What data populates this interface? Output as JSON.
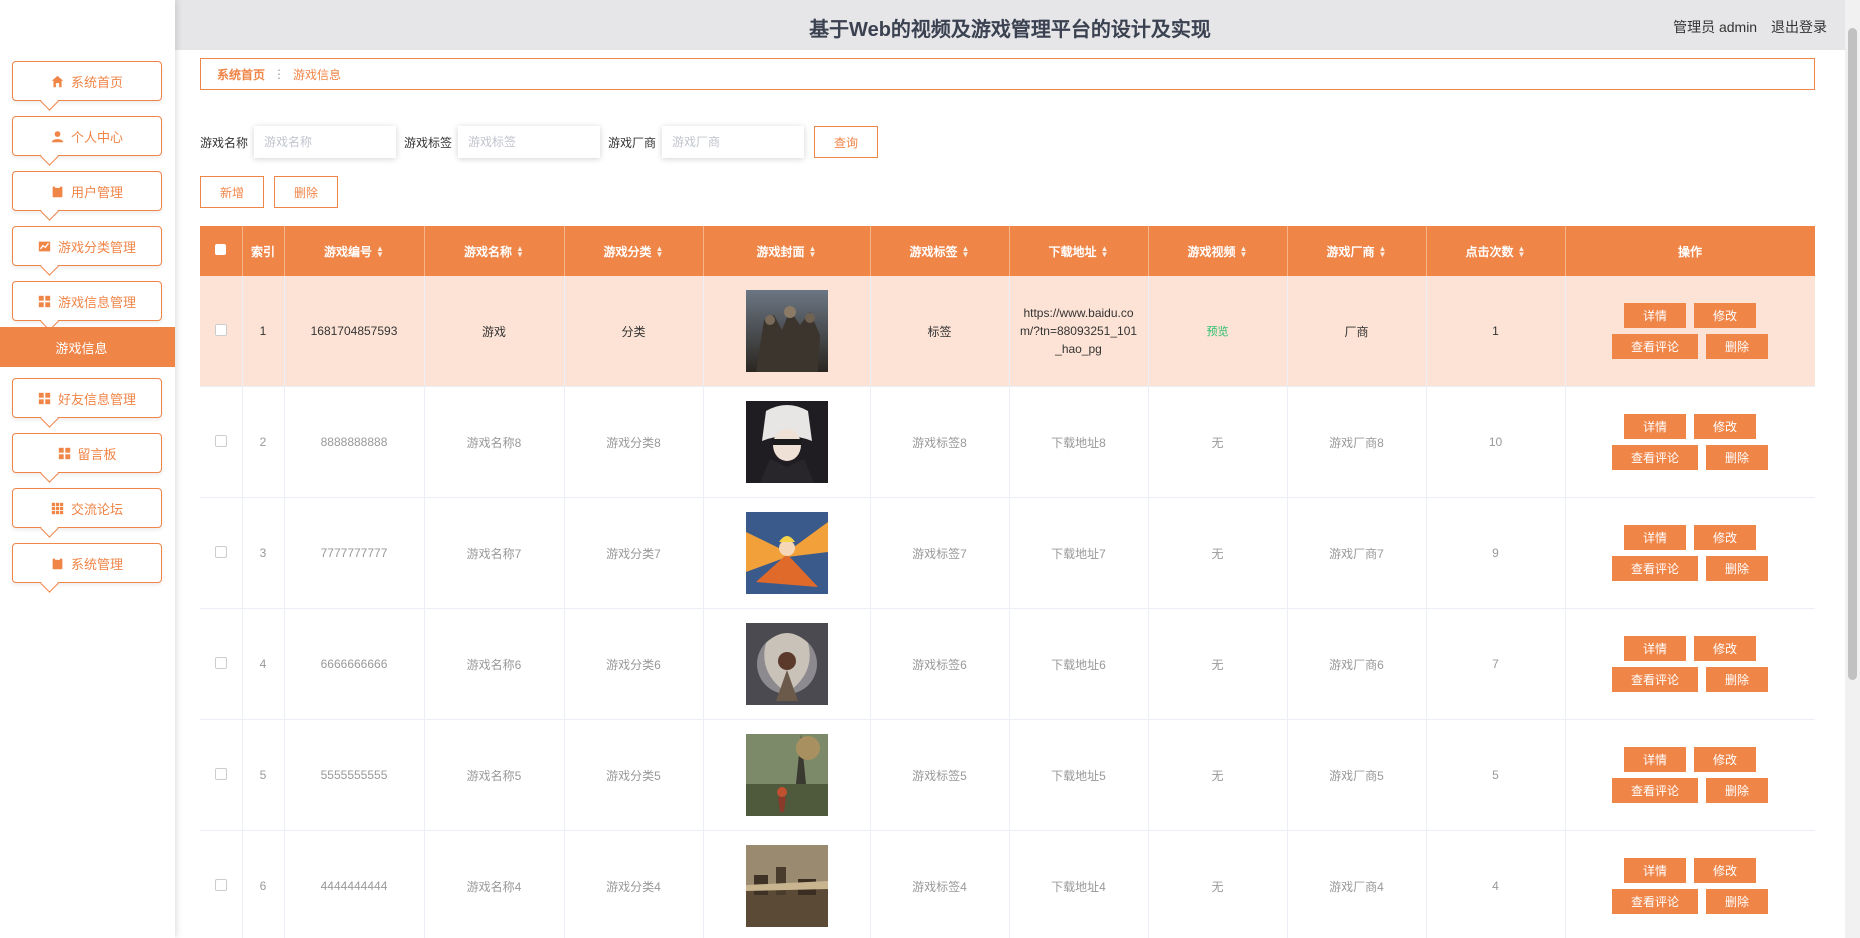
{
  "header": {
    "title": "基于Web的视频及游戏管理平台的设计及实现",
    "user_label": "管理员 admin",
    "logout": "退出登录"
  },
  "sidebar": {
    "items": [
      {
        "label": "系统首页",
        "icon": "home-icon"
      },
      {
        "label": "个人中心",
        "icon": "user-icon"
      },
      {
        "label": "用户管理",
        "icon": "clipboard-icon"
      },
      {
        "label": "游戏分类管理",
        "icon": "chart-icon"
      },
      {
        "label": "游戏信息管理",
        "icon": "grid-icon"
      },
      {
        "label": "好友信息管理",
        "icon": "grid-icon"
      },
      {
        "label": "留言板",
        "icon": "grid-icon"
      },
      {
        "label": "交流论坛",
        "icon": "apps-icon"
      },
      {
        "label": "系统管理",
        "icon": "clipboard-icon"
      }
    ],
    "active_sub": "游戏信息"
  },
  "breadcrumb": {
    "home": "系统首页",
    "current": "游戏信息"
  },
  "search": {
    "fields": [
      {
        "label": "游戏名称",
        "placeholder": "游戏名称"
      },
      {
        "label": "游戏标签",
        "placeholder": "游戏标签"
      },
      {
        "label": "游戏厂商",
        "placeholder": "游戏厂商"
      }
    ],
    "query_label": "查询"
  },
  "actions": {
    "add_label": "新增",
    "delete_label": "删除"
  },
  "table": {
    "columns": [
      "索引",
      "游戏编号",
      "游戏名称",
      "游戏分类",
      "游戏封面",
      "游戏标签",
      "下载地址",
      "游戏视频",
      "游戏厂商",
      "点击次数",
      "操作"
    ],
    "rows": [
      {
        "index": "1",
        "code": "1681704857593",
        "name": "游戏",
        "category": "分类",
        "tag": "标签",
        "url": "https://www.baidu.com/?tn=88093251_101_hao_pg",
        "video": "预览",
        "vendor": "厂商",
        "clicks": "1"
      },
      {
        "index": "2",
        "code": "8888888888",
        "name": "游戏名称8",
        "category": "游戏分类8",
        "tag": "游戏标签8",
        "url": "下载地址8",
        "video": "无",
        "vendor": "游戏厂商8",
        "clicks": "10"
      },
      {
        "index": "3",
        "code": "7777777777",
        "name": "游戏名称7",
        "category": "游戏分类7",
        "tag": "游戏标签7",
        "url": "下载地址7",
        "video": "无",
        "vendor": "游戏厂商7",
        "clicks": "9"
      },
      {
        "index": "4",
        "code": "6666666666",
        "name": "游戏名称6",
        "category": "游戏分类6",
        "tag": "游戏标签6",
        "url": "下载地址6",
        "video": "无",
        "vendor": "游戏厂商6",
        "clicks": "7"
      },
      {
        "index": "5",
        "code": "5555555555",
        "name": "游戏名称5",
        "category": "游戏分类5",
        "tag": "游戏标签5",
        "url": "下载地址5",
        "video": "无",
        "vendor": "游戏厂商5",
        "clicks": "5"
      },
      {
        "index": "6",
        "code": "4444444444",
        "name": "游戏名称4",
        "category": "游戏分类4",
        "tag": "游戏标签4",
        "url": "下载地址4",
        "video": "无",
        "vendor": "游戏厂商4",
        "clicks": "4"
      }
    ],
    "ops": {
      "detail": "详情",
      "edit": "修改",
      "comments": "查看评论",
      "delete": "删除"
    }
  },
  "colors": {
    "accent": "#f08548",
    "highlight_row": "#fde3d6",
    "header_bg": "#e6e6e8",
    "video_link": "#2cbf6d"
  }
}
